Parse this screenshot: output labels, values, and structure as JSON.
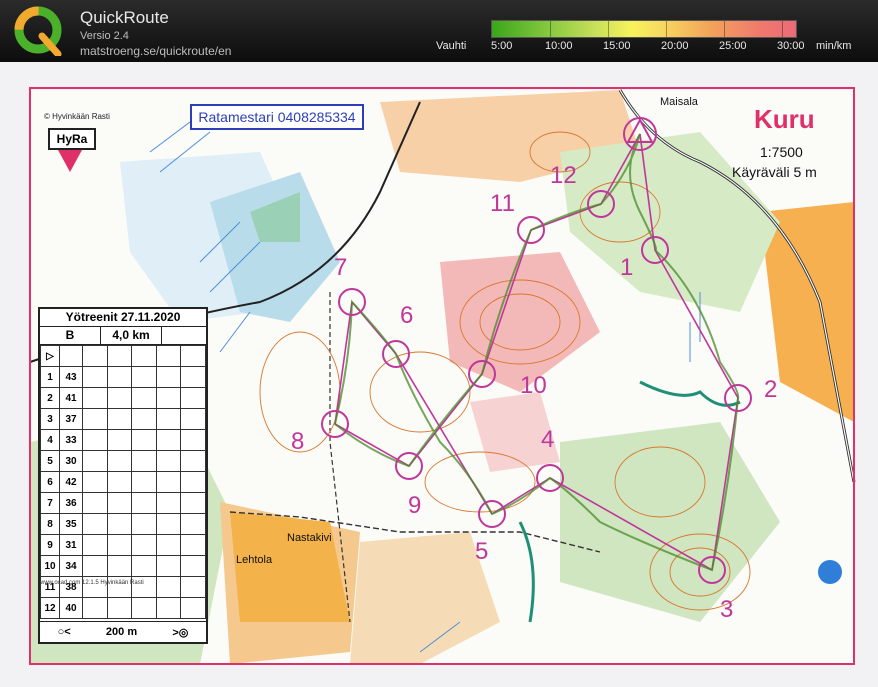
{
  "app": {
    "title": "QuickRoute",
    "version": "Versio 2.4",
    "url": "matstroeng.se/quickroute/en"
  },
  "pace_scale": {
    "label": "Vauhti",
    "ticks": [
      "5:00",
      "10:00",
      "15:00",
      "20:00",
      "25:00",
      "30:00"
    ],
    "unit": "min/km",
    "colors": [
      "#3aa61a",
      "#c8e05a",
      "#f7f25c",
      "#f4a25a",
      "#ec6a78"
    ]
  },
  "map": {
    "copyright": "© Hyvinkään Rasti",
    "club_logo": "HyRa",
    "phone_box": "Ratamestari 0408285334",
    "area_name": "Kuru",
    "scale": "1:7500",
    "contour_interval": "Käyräväli 5 m",
    "place_names": [
      "Maisala",
      "Nastakivi",
      "Lehtola"
    ],
    "frame_color": "#e0306a",
    "course_color": "#c0379a"
  },
  "legend": {
    "event": "Yötreenit 27.11.2020",
    "course": "B",
    "length": "4,0 km",
    "controls": [
      {
        "n": "1",
        "code": "43"
      },
      {
        "n": "2",
        "code": "41"
      },
      {
        "n": "3",
        "code": "37"
      },
      {
        "n": "4",
        "code": "33"
      },
      {
        "n": "5",
        "code": "30"
      },
      {
        "n": "6",
        "code": "42"
      },
      {
        "n": "7",
        "code": "36"
      },
      {
        "n": "8",
        "code": "35"
      },
      {
        "n": "9",
        "code": "31"
      },
      {
        "n": "10",
        "code": "34"
      },
      {
        "n": "11",
        "code": "38"
      },
      {
        "n": "12",
        "code": "40"
      }
    ],
    "finish_distance": "200 m",
    "fine_print": "www.ocad.com 12.1.5 Hyvinkään Rasti"
  },
  "course": {
    "control_labels": [
      "1",
      "2",
      "3",
      "4",
      "5",
      "6",
      "7",
      "8",
      "9",
      "10",
      "11",
      "12"
    ]
  }
}
